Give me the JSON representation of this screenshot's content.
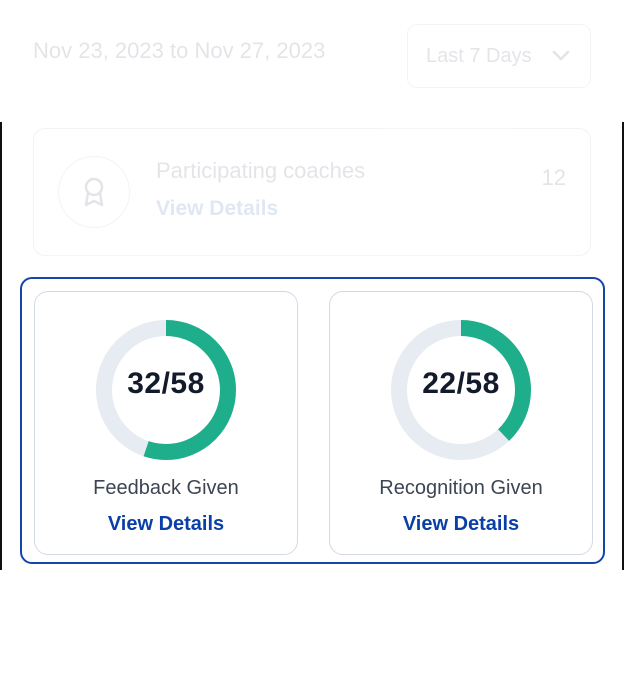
{
  "header": {
    "date_range": "Nov 23, 2023 to Nov 27, 2023",
    "range_select": {
      "selected": "Last 7 Days",
      "icon": "chevron-down-icon"
    }
  },
  "coaches_card": {
    "icon": "award-icon",
    "label": "Participating coaches",
    "link": "View Details",
    "count": "12"
  },
  "stats": [
    {
      "value_text": "32/58",
      "completed": 32,
      "total": 58,
      "label": "Feedback Given",
      "link": "View Details"
    },
    {
      "value_text": "22/58",
      "completed": 22,
      "total": 58,
      "label": "Recognition Given",
      "link": "View Details"
    }
  ],
  "colors": {
    "donut_fill": "#1fae8c",
    "donut_track": "#e7ebf2",
    "link": "#0b3fa8",
    "highlight_border": "#1246a8"
  }
}
